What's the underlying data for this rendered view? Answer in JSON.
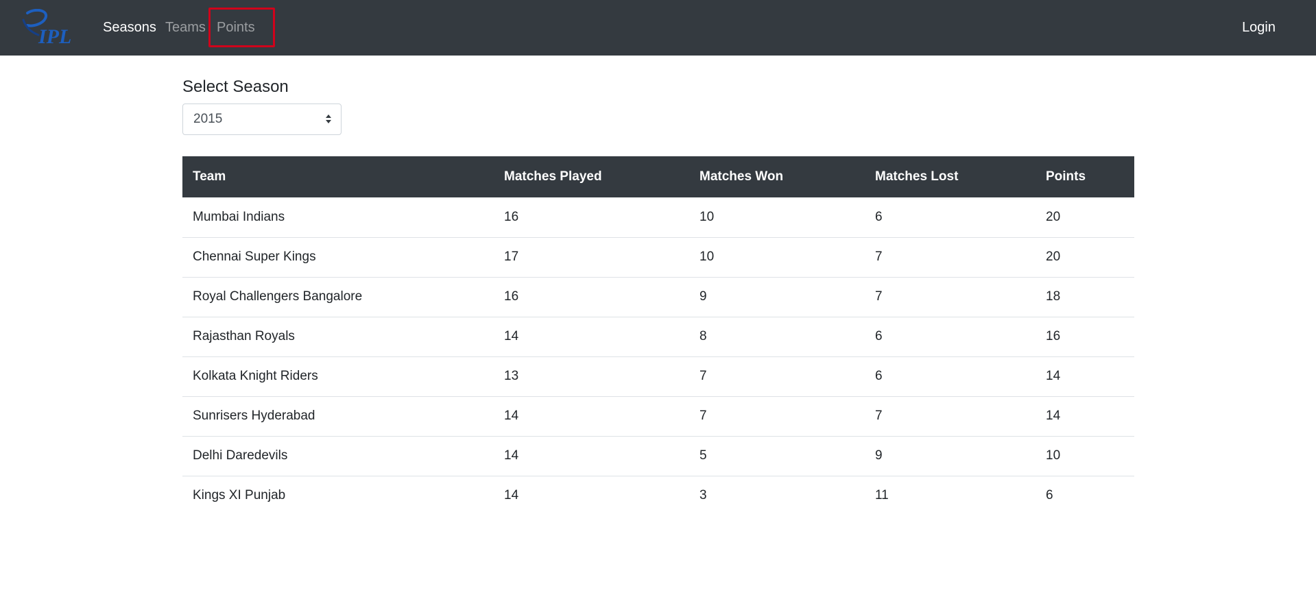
{
  "colors": {
    "navbar_bg": "#343a40",
    "table_header_bg": "#343a40",
    "highlight_border": "#d0021b",
    "logo_blue": "#1d5fbf"
  },
  "navbar": {
    "logo_text": "IPL",
    "links": [
      {
        "label": "Seasons",
        "active": true
      },
      {
        "label": "Teams",
        "active": false
      },
      {
        "label": "Points",
        "active": false
      }
    ],
    "login_label": "Login"
  },
  "season": {
    "label": "Select Season",
    "selected": "2015"
  },
  "table": {
    "headers": [
      "Team",
      "Matches Played",
      "Matches Won",
      "Matches Lost",
      "Points"
    ],
    "rows": [
      [
        "Mumbai Indians",
        "16",
        "10",
        "6",
        "20"
      ],
      [
        "Chennai Super Kings",
        "17",
        "10",
        "7",
        "20"
      ],
      [
        "Royal Challengers Bangalore",
        "16",
        "9",
        "7",
        "18"
      ],
      [
        "Rajasthan Royals",
        "14",
        "8",
        "6",
        "16"
      ],
      [
        "Kolkata Knight Riders",
        "13",
        "7",
        "6",
        "14"
      ],
      [
        "Sunrisers Hyderabad",
        "14",
        "7",
        "7",
        "14"
      ],
      [
        "Delhi Daredevils",
        "14",
        "5",
        "9",
        "10"
      ],
      [
        "Kings XI Punjab",
        "14",
        "3",
        "11",
        "6"
      ]
    ]
  }
}
